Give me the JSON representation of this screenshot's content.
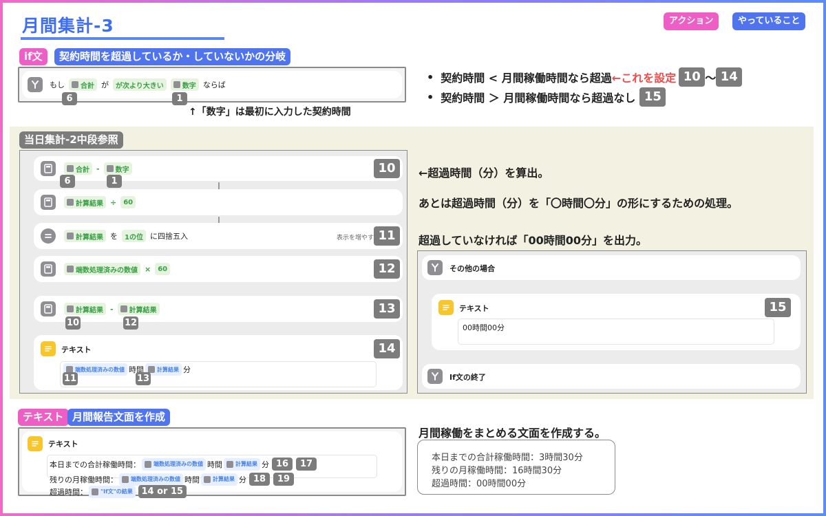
{
  "page": {
    "title": "月間集計-3",
    "legend": {
      "action": "アクション",
      "doing": "やっていること"
    }
  },
  "if_section": {
    "tag": "if文",
    "desc": "契約時間を超過しているか・していないかの分岐",
    "row": {
      "prefix": "もし",
      "var1": "合計",
      "mid": "が",
      "cond": "が次より大きい",
      "var2": "数字",
      "suffix": "ならば"
    },
    "badges": {
      "var1": "6",
      "var2": "1"
    },
    "note": "↑「数字」は最初に入力した契約時間",
    "bullets": [
      {
        "pre": "契約時間 < 月間稼働時間なら超過",
        "highlight": "←これを設定",
        "n1": "10",
        "sep": "〜",
        "n2": "14"
      },
      {
        "pre": "契約時間 ＞ 月間稼働時間なら超過なし",
        "n1": "15"
      }
    ]
  },
  "day_section": {
    "label": "当日集計-2中段参照",
    "rows": [
      {
        "a": "合計",
        "op": "-",
        "b": "数字",
        "badge": "10",
        "ba": "6",
        "bb": "1"
      },
      {
        "a": "計算結果",
        "op": "÷",
        "b": "60"
      },
      {
        "a": "計算結果",
        "mid1": "を",
        "b": "1の位",
        "mid2": "に四捨五入",
        "more": "表示を増やす",
        "badge": "11"
      },
      {
        "a": "端数処理済みの数値",
        "op": "×",
        "b": "60",
        "badge": "12"
      },
      {
        "a": "計算結果",
        "op": "-",
        "b": "計算結果",
        "badge": "13",
        "ba": "10",
        "bb": "12"
      }
    ],
    "text_card": {
      "label": "テキスト",
      "var1": "端数処理済みの数値",
      "mid": "時間",
      "var2": "計算結果",
      "suffix": "分",
      "badge": "14",
      "b1": "11",
      "b2": "13"
    },
    "notes": [
      "←超過時間（分）を算出。",
      "あとは超過時間（分）を「〇時間〇分」の形にするための処理。",
      "超過していなければ「00時間00分」を出力。"
    ],
    "else_panel": {
      "else_label": "その他の場合",
      "text_label": "テキスト",
      "text_value": "00時間00分",
      "badge": "15",
      "end_label": "If文の終了"
    }
  },
  "text_section": {
    "tag": "テキスト",
    "desc": "月間報告文面を作成",
    "card_label": "テキスト",
    "lines": [
      {
        "pre": "本日までの合計稼働時間：",
        "v1": "端数処理済みの数値",
        "mid": "時間",
        "v2": "計算結果",
        "suf": "分",
        "b1": "16",
        "b2": "17"
      },
      {
        "pre": "残りの月稼働時間：",
        "v1": "端数処理済みの数値",
        "mid": "時間",
        "v2": "計算結果",
        "suf": "分",
        "b1": "18",
        "b2": "19"
      },
      {
        "pre": "超過時間：",
        "v1": "\"If文\"の結果",
        "b1": "14 or 15"
      }
    ],
    "note": "月間稼働をまとめる文面を作成する。",
    "sample": [
      "本日までの合計稼働時間：3時間30分",
      "残りの月稼働時間：16時間30分",
      "超過時間：00時間00分"
    ]
  },
  "colors": {
    "accent": "#3f6ff0",
    "pink": "#ee5fc6",
    "blue": "#4f74ee",
    "badge": "#7c7c7c",
    "beige": "#f3f1e2"
  }
}
